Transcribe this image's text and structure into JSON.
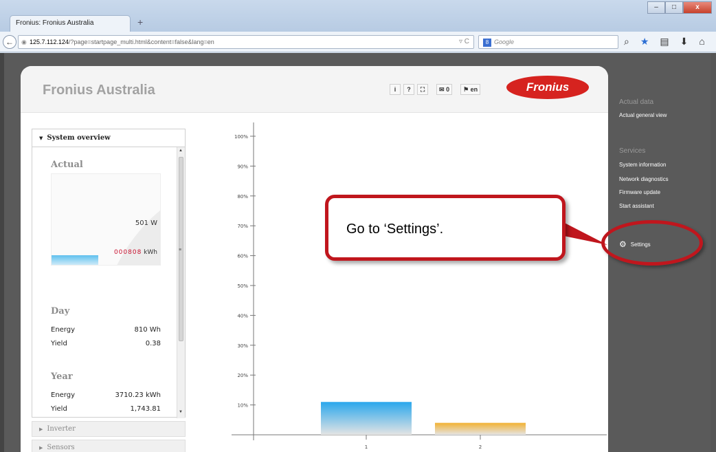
{
  "browser": {
    "tab_title": "Fronius: Fronius Australia",
    "new_tab": "+",
    "url_host": "125.7.112.124",
    "url_rest": "/?page=startpage_multi.html&content=false&lang=en",
    "search_placeholder": "Google",
    "search_engine": "8"
  },
  "header": {
    "title": "Fronius Australia",
    "icons": [
      "info-icon",
      "help-icon",
      "fullscreen-icon"
    ],
    "mail_count": "0",
    "language": "en",
    "logo_text": "Fronius",
    "accent": "#d6231f"
  },
  "panel": {
    "title": "System overview",
    "actual_heading": "Actual",
    "power": "501 W",
    "counter": "000808",
    "energy_unit": "kWh",
    "day_heading": "Day",
    "day_rows": [
      {
        "label": "Energy",
        "value": "810 Wh"
      },
      {
        "label": "Yield",
        "value": "0.38"
      }
    ],
    "year_heading": "Year",
    "year_rows": [
      {
        "label": "Energy",
        "value": "3710.23 kWh"
      },
      {
        "label": "Yield",
        "value": "1,743.81"
      }
    ]
  },
  "collapsed_sections": [
    "Inverter",
    "Sensors"
  ],
  "sidebar": {
    "actual_heading": "Actual data",
    "actual_items": [
      "Actual general view"
    ],
    "services_heading": "Services",
    "services_items": [
      "System information",
      "Network diagnostics",
      "Firmware update",
      "Start assistant"
    ],
    "settings": "Settings"
  },
  "annotation": {
    "callout_text": "Go to ‘Settings’.",
    "color": "#c0161d"
  },
  "chart_data": {
    "type": "bar",
    "categories": [
      "1",
      "2"
    ],
    "values": [
      11,
      4
    ],
    "colors": [
      "#2aa7ec",
      "#f2b233"
    ],
    "yticks": [
      "100%",
      "90%",
      "80%",
      "70%",
      "60%",
      "50%",
      "40%",
      "30%",
      "20%",
      "10%"
    ],
    "ylim": [
      0,
      100
    ]
  }
}
